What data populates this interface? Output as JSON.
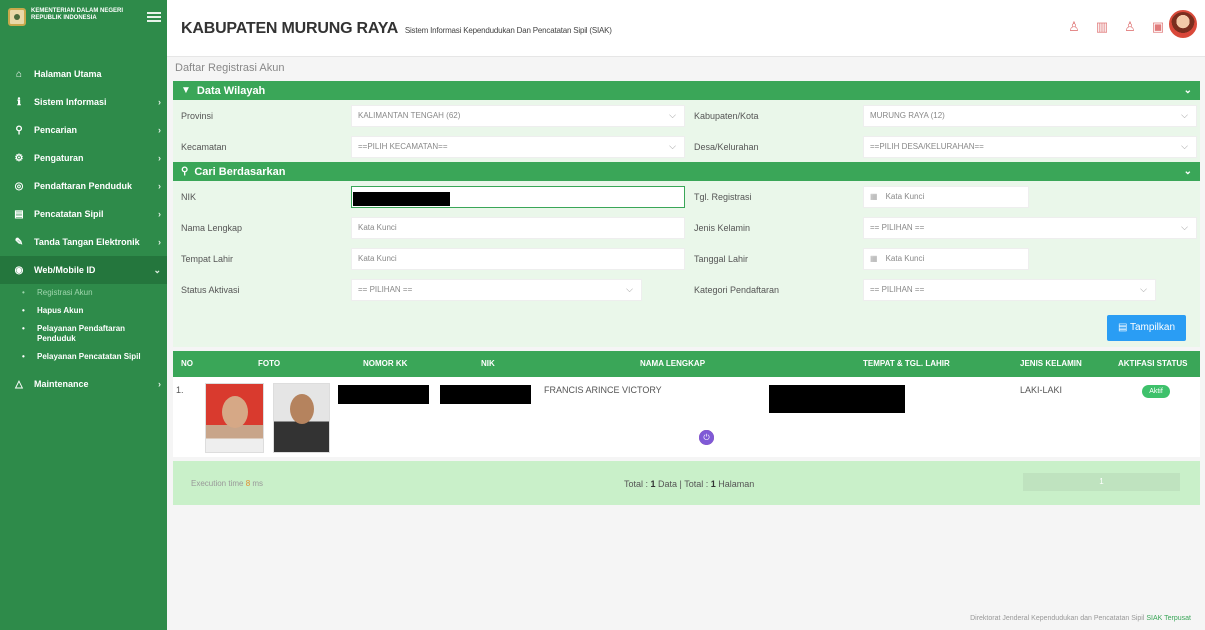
{
  "sidebar": {
    "ministry": "KEMENTERIAN DALAM NEGERI REPUBLIK INDONESIA",
    "items": [
      {
        "label": "Halaman Utama",
        "icon": "home-icon"
      },
      {
        "label": "Sistem Informasi",
        "icon": "info-icon"
      },
      {
        "label": "Pencarian",
        "icon": "search-icon"
      },
      {
        "label": "Pengaturan",
        "icon": "settings-icon"
      },
      {
        "label": "Pendaftaran Penduduk",
        "icon": "register-icon"
      },
      {
        "label": "Pencatatan Sipil",
        "icon": "document-icon"
      },
      {
        "label": "Tanda Tangan Elektronik",
        "icon": "signature-icon"
      },
      {
        "label": "Web/Mobile ID",
        "icon": "web-id-icon"
      },
      {
        "label": "Maintenance",
        "icon": "maintenance-icon"
      }
    ],
    "subitems": [
      "Registrasi Akun",
      "Hapus Akun",
      "Pelayanan Pendaftaran Penduduk",
      "Pelayanan Pencatatan Sipil"
    ]
  },
  "header": {
    "title": "KABUPATEN MURUNG RAYA",
    "subtitle": "Sistem Informasi Kependudukan Dan Pencatatan Sipil (SIAK)"
  },
  "breadcrumb": "Daftar Registrasi Akun",
  "wilayah": {
    "title": "Data Wilayah",
    "provinsi_label": "Provinsi",
    "provinsi_value": "KALIMANTAN TENGAH (62)",
    "kabupaten_label": "Kabupaten/Kota",
    "kabupaten_value": "MURUNG RAYA (12)",
    "kecamatan_label": "Kecamatan",
    "kecamatan_value": "==PILIH KECAMATAN==",
    "desa_label": "Desa/Kelurahan",
    "desa_value": "==PILIH DESA/KELURAHAN=="
  },
  "search": {
    "title": "Cari Berdasarkan",
    "nik_label": "NIK",
    "tgl_reg_label": "Tgl. Registrasi",
    "tgl_reg_placeholder": "Kata Kunci",
    "nama_label": "Nama Lengkap",
    "nama_placeholder": "Kata Kunci",
    "jk_label": "Jenis Kelamin",
    "jk_value": "== PILIHAN ==",
    "tempat_label": "Tempat Lahir",
    "tempat_placeholder": "Kata Kunci",
    "tgl_lahir_label": "Tanggal Lahir",
    "tgl_lahir_placeholder": "Kata Kunci",
    "status_label": "Status Aktivasi",
    "status_value": "== PILIHAN ==",
    "kategori_label": "Kategori Pendaftaran",
    "kategori_value": "== PILIHAN ==",
    "button": "Tampilkan"
  },
  "table": {
    "headers": [
      "NO",
      "FOTO",
      "NOMOR KK",
      "NIK",
      "NAMA LENGKAP",
      "TEMPAT & TGL. LAHIR",
      "JENIS KELAMIN",
      "AKTIFASI STATUS"
    ],
    "row": {
      "no": "1.",
      "nama": "FRANCIS ARINCE VICTORY",
      "jenis_kelamin": "LAKI-LAKI",
      "status": "Aktif"
    }
  },
  "footer_bar": {
    "exec_prefix": "Execution time",
    "exec_value": "8",
    "exec_unit": "ms",
    "total_prefix": "Total : ",
    "total_data": "1",
    "total_mid": " Data | Total : ",
    "total_pages": "1",
    "total_suffix": " Halaman",
    "page": "1"
  },
  "footer": {
    "text": "Direktorat Jenderal Kependudukan dan Pencatatan Sipil",
    "link": "SIAK Terpusat"
  }
}
